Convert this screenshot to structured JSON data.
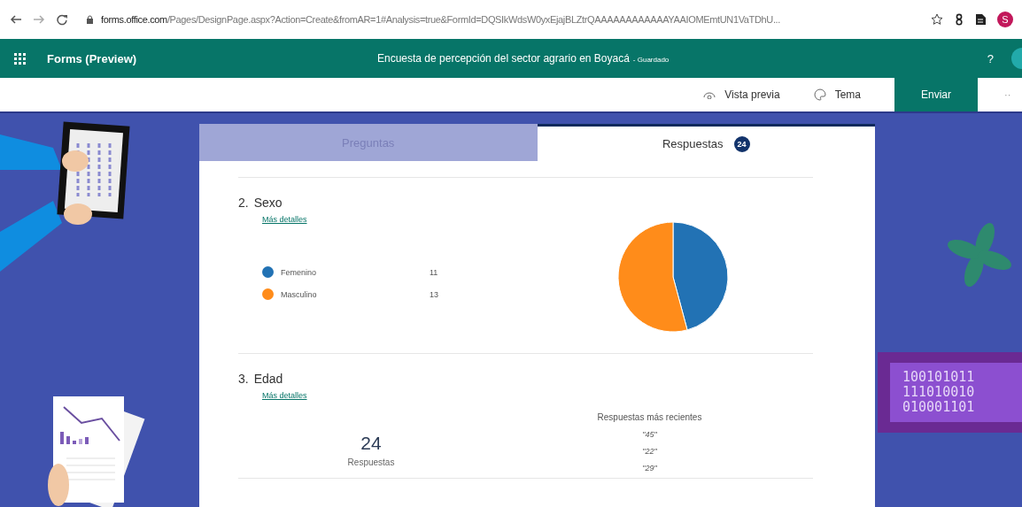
{
  "browser": {
    "url_domain": "forms.office.com",
    "url_path": "/Pages/DesignPage.aspx?Action=Create&fromAR=1#Analysis=true&FormId=DQSIkWdsW0yxEjajBLZtrQAAAAAAAAAAAAYAAIOMEmtUN1VaTDhU...",
    "profile_initial": "S"
  },
  "app_bar": {
    "app_name": "Forms (Preview)",
    "form_title": "Encuesta de percepción del sector agrario en Boyacá",
    "save_status": "- Guardado",
    "help": "?"
  },
  "toolbar": [
    {
      "kind": "preview",
      "label": "Vista previa"
    },
    {
      "kind": "theme",
      "label": "Tema"
    },
    {
      "kind": "primary",
      "label": "Enviar"
    },
    {
      "kind": "more",
      "label": "··"
    }
  ],
  "tabs": [
    {
      "label": "Preguntas",
      "selected": false
    },
    {
      "label": "Respuestas",
      "selected": true,
      "badge": "24"
    }
  ],
  "questions": [
    {
      "kind": "choice",
      "number": "2.",
      "title": "Sexo",
      "link": "Más detalles",
      "options": [
        {
          "label": "Femenino",
          "count": "11",
          "color": "#2272b4"
        },
        {
          "label": "Masculino",
          "count": "13",
          "color": "#ff8c1a"
        }
      ]
    },
    {
      "kind": "text",
      "number": "3.",
      "title": "Edad",
      "link": "Más detalles",
      "count": "24",
      "count_label": "Respuestas",
      "recent_heading": "Respuestas más recientes",
      "recent": [
        "\"45\"",
        "\"22\"",
        "\"29\""
      ]
    }
  ],
  "decoration": {
    "monitor_lines": [
      "100101011",
      "111010010",
      "010001101"
    ]
  }
}
